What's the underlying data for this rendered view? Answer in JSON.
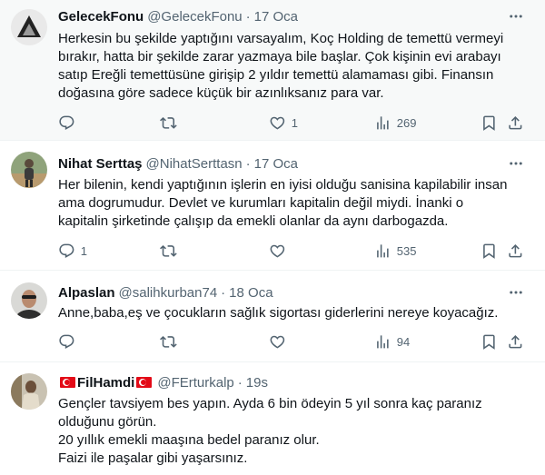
{
  "tweets": [
    {
      "name": "GelecekFonu",
      "handle": "@GelecekFonu",
      "sep": "·",
      "time": "17 Oca",
      "lines": [
        "Herkesin bu şekilde yaptığını varsayalım, Koç Holding de temettü vermeyi",
        "bırakır, hatta bir şekilde zarar yazmaya bile başlar. Çok kişinin evi arabayı",
        "satıp Ereğli temettüsüne girişip 2 yıldır temettü alamaması gibi. Finansın",
        "doğasına göre sadece küçük bir azınlıksanız para var."
      ],
      "replies": "",
      "retweets": "",
      "likes": "1",
      "views": "269"
    },
    {
      "name": "Nihat Serttaş",
      "handle": "@NihatSerttasn",
      "sep": "·",
      "time": "17 Oca",
      "lines": [
        "Her bilenin, kendi yaptığının işlerin en iyisi olduğu sanisina kapilabilir insan",
        "ama dogrumudur. Devlet ve kurumları kapitalin değil miydi. İnanki o",
        "kapitalin şirketinde çalışıp da emekli olanlar da  aynı darbogazda."
      ],
      "replies": "1",
      "retweets": "",
      "likes": "",
      "views": "535"
    },
    {
      "name": "Alpaslan",
      "handle": "@salihkurban74",
      "sep": "·",
      "time": "18 Oca",
      "lines": [
        "Anne,baba,eş ve çocukların sağlık sigortası giderlerini nereye koyacağız."
      ],
      "replies": "",
      "retweets": "",
      "likes": "",
      "views": "94"
    },
    {
      "name": "FilHamdi",
      "handle": "@FErturkalp",
      "sep": "·",
      "time": "19s",
      "lines": [
        "Gençler tavsiyem bes yapın. Ayda 6 bin ödeyin 5 yıl sonra kaç paranız",
        "olduğunu görün.",
        "20 yıllık emekli maaşına bedel paranız olur.",
        "Faizi ile paşalar gibi yaşarsınız."
      ]
    }
  ],
  "icons": {
    "reply": "reply-icon",
    "retweet": "retweet-icon",
    "like": "heart-icon",
    "views": "views-icon",
    "bookmark": "bookmark-icon",
    "share": "share-icon",
    "more": "more-icon",
    "flag": "turkey-flag-icon"
  },
  "colors": {
    "text": "#0f1419",
    "secondary": "#536471",
    "highlight_bg": "#f7f9f9",
    "divider": "#eff3f4"
  }
}
